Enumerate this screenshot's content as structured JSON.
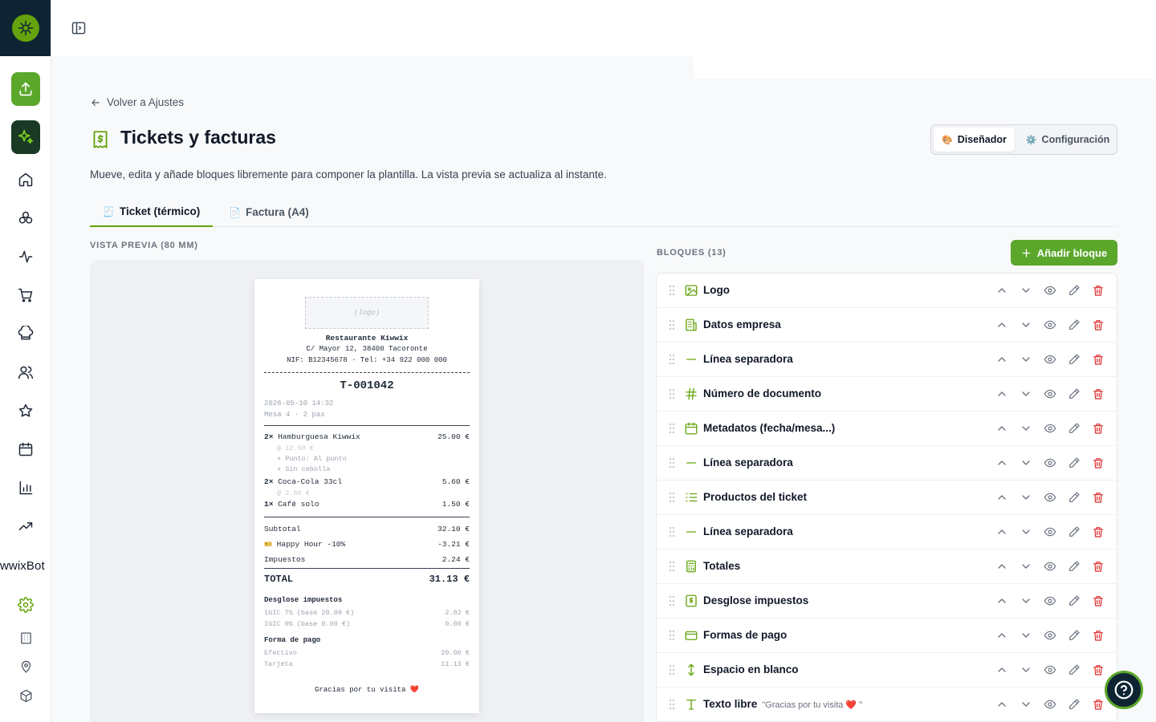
{
  "sidebar": {
    "bot_label": "wwixBot"
  },
  "header": {
    "back_label": "Volver a Ajustes",
    "title": "Tickets y facturas",
    "subtitle": "Mueve, edita y añade bloques libremente para componer la plantilla. La vista previa se actualiza al instante."
  },
  "mode_switch": {
    "designer": "Diseñador",
    "config": "Configuración"
  },
  "tabs": {
    "ticket": "Ticket (térmico)",
    "invoice": "Factura (A4)"
  },
  "preview": {
    "label": "VISTA PREVIA (80 MM)"
  },
  "ticket": {
    "logo_placeholder": "(logo)",
    "business_name": "Restaurante Kiwwix",
    "address": "C/ Mayor 12, 38400 Tacoronte",
    "tax_line": "NIF: B12345678 · Tel: +34 922 000 000",
    "doc_number": "T-001042",
    "datetime": "2026-05-10 14:32",
    "table_info": "Mesa 4 · 2 pax",
    "items": [
      {
        "qty": "2×",
        "name": "Hamburguesa Kiwwix",
        "price": "25.00 €"
      },
      {
        "unit": "@ 12.50 €"
      },
      {
        "mod1": "+ Punto: Al punto"
      },
      {
        "mod2": "+ Sin cebolla"
      },
      {
        "qty": "2×",
        "name": "Coca-Cola 33cl",
        "price": "5.60 €"
      },
      {
        "unit": "@ 2.80 €"
      },
      {
        "qty": "1×",
        "name": "Café solo",
        "price": "1.50 €"
      }
    ],
    "subtotal_label": "Subtotal",
    "subtotal_value": "32.10 €",
    "promo_label": "Happy Hour -10%",
    "promo_value": "-3.21 €",
    "tax_label": "Impuestos",
    "tax_value": "2.24 €",
    "total_label": "TOTAL",
    "total_value": "31.13 €",
    "tax_breakdown_title": "Desglose impuestos",
    "tax_rows": [
      {
        "label": "IGIC 7% (base 28.89 €)",
        "value": "2.02 €"
      },
      {
        "label": "IGIC 0% (base 0.00 €)",
        "value": "0.00 €"
      }
    ],
    "payment_title": "Forma de pago",
    "payments": [
      {
        "label": "Efectivo",
        "value": "20.00 €"
      },
      {
        "label": "Tarjeta",
        "value": "11.13 €"
      }
    ],
    "footer": "Gracias por tu visita ❤️"
  },
  "blocks": {
    "label": "BLOQUES (13)",
    "add_label": "Añadir bloque",
    "items": [
      {
        "icon": "image-icon",
        "label": "Logo"
      },
      {
        "icon": "building-icon",
        "label": "Datos empresa"
      },
      {
        "icon": "minus-icon",
        "label": "Línea separadora"
      },
      {
        "icon": "hash-icon",
        "label": "Número de documento"
      },
      {
        "icon": "calendar-icon",
        "label": "Metadatos (fecha/mesa...)"
      },
      {
        "icon": "minus-icon",
        "label": "Línea separadora"
      },
      {
        "icon": "list-icon",
        "label": "Productos del ticket"
      },
      {
        "icon": "minus-icon",
        "label": "Línea separadora"
      },
      {
        "icon": "calculator-icon",
        "label": "Totales"
      },
      {
        "icon": "receipt-icon",
        "label": "Desglose impuestos"
      },
      {
        "icon": "card-icon",
        "label": "Formas de pago"
      },
      {
        "icon": "vertical-arrows-icon",
        "label": "Espacio en blanco"
      },
      {
        "icon": "text-icon",
        "label": "Texto libre",
        "extra": "\"Gracias por tu visita ❤️ \""
      }
    ]
  },
  "colors": {
    "accent": "#5ba72c",
    "brand_dark": "#0f2433",
    "danger": "#dc2626"
  }
}
